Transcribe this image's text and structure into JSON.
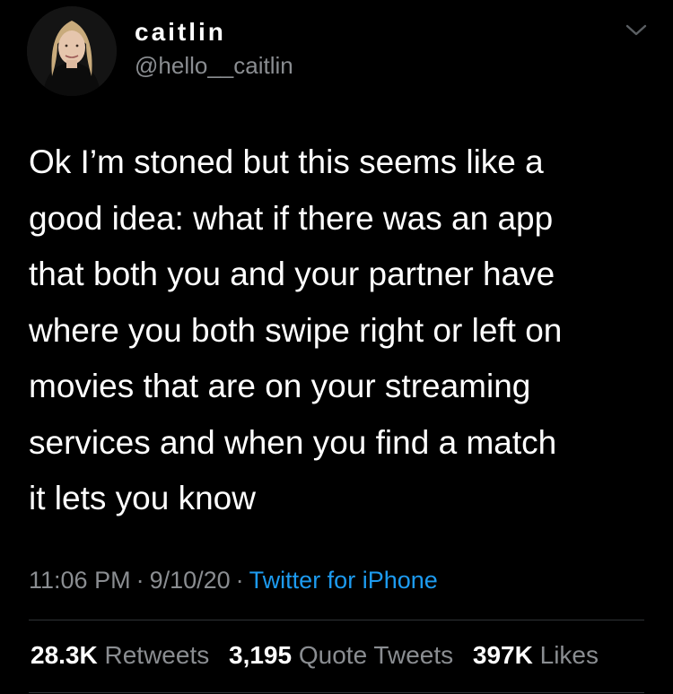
{
  "user": {
    "display_name": "caitlin",
    "handle": "@hello__caitlin"
  },
  "icons": {
    "avatar": "profile-photo",
    "menu": "chevron-down-icon"
  },
  "tweet": {
    "lines": [
      "Ok I’m stoned but this seems like a",
      "good idea: what if there was an app",
      "that both you and your partner have",
      "where you both swipe right or left on",
      "movies that are on your streaming",
      "services and when you find a match",
      "it lets you know"
    ]
  },
  "meta": {
    "time": "11:06 PM",
    "separator": "·",
    "date": "9/10/20",
    "source": "Twitter for iPhone"
  },
  "stats": {
    "retweets": {
      "count": "28.3K",
      "label": "Retweets"
    },
    "quote_tweets": {
      "count": "3,195",
      "label": "Quote Tweets"
    },
    "likes": {
      "count": "397K",
      "label": "Likes"
    }
  },
  "colors": {
    "background": "#000000",
    "text": "#ffffff",
    "secondary_text": "#8a8d91",
    "link": "#1d9bf0",
    "divider": "#2f3336"
  }
}
